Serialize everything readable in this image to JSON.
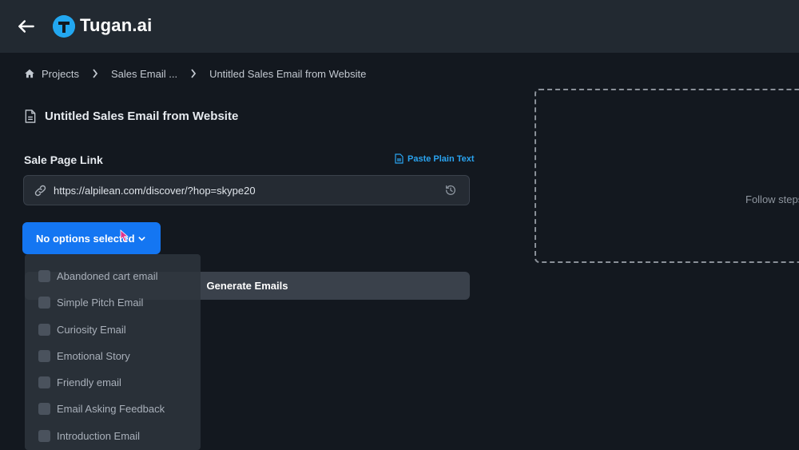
{
  "header": {
    "brand": "Tugan.ai",
    "brand_color": "#22a7f0",
    "icons": {
      "back": "arrow-left-icon",
      "logo": "tugan-logo-icon"
    }
  },
  "breadcrumb": {
    "items": [
      "Projects",
      "Sales Email ...",
      "Untitled Sales Email from Website"
    ]
  },
  "document": {
    "title": "Untitled Sales Email from Website"
  },
  "form": {
    "sale_page_label": "Sale Page Link",
    "paste_plain_text": "Paste Plain Text",
    "url_value": "https://alpilean.com/discover/?hop=skype20",
    "select_label": "No options selected",
    "generate_label": "Generate Emails"
  },
  "dropdown": {
    "options": [
      "Abandoned cart email",
      "Simple Pitch Email",
      "Curiosity Email",
      "Emotional Story",
      "Friendly email",
      "Email Asking Feedback",
      "Introduction Email"
    ]
  },
  "preview": {
    "text": "Follow steps"
  },
  "colors": {
    "background": "#13181f",
    "topbar": "#222931",
    "accent": "#1476f2",
    "link": "#2aa3ef"
  }
}
